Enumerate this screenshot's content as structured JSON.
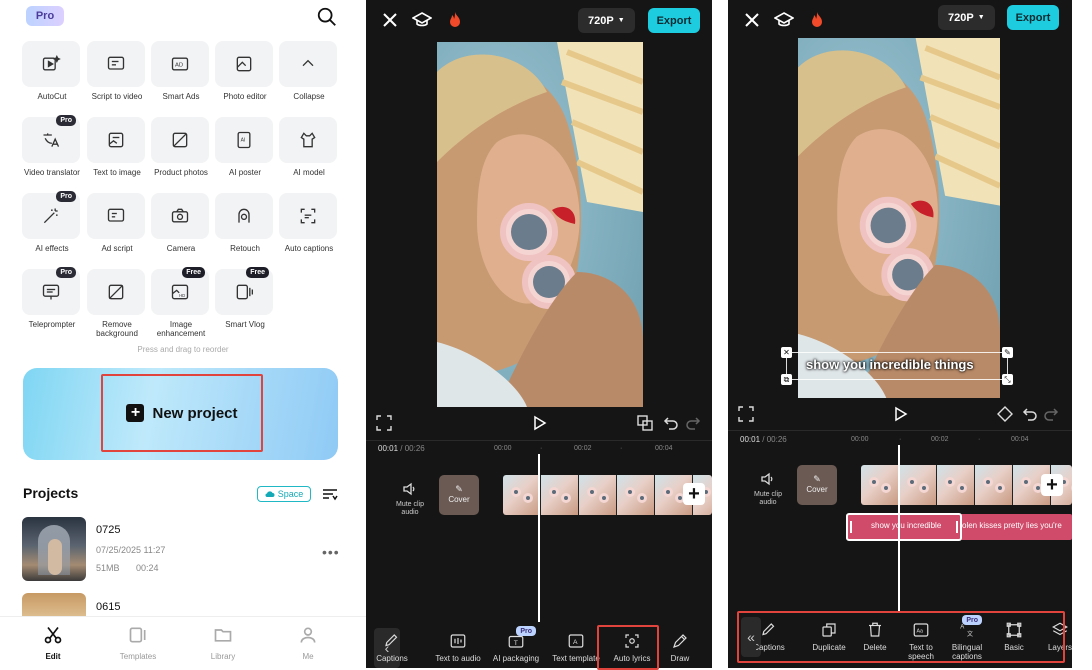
{
  "left_panel": {
    "pro_badge": "Pro",
    "tools": [
      {
        "label": "AutoCut",
        "icon": "autocut-icon",
        "badge": ""
      },
      {
        "label": "Script to video",
        "icon": "script-to-video-icon",
        "badge": ""
      },
      {
        "label": "Smart Ads",
        "icon": "smart-ads-icon",
        "badge": ""
      },
      {
        "label": "Photo editor",
        "icon": "photo-editor-icon",
        "badge": ""
      },
      {
        "label": "Collapse",
        "icon": "chevron-up-icon",
        "badge": ""
      },
      {
        "label": "Video translator",
        "icon": "translate-icon",
        "badge": "Pro"
      },
      {
        "label": "Text to image",
        "icon": "text-to-image-icon",
        "badge": ""
      },
      {
        "label": "Product photos",
        "icon": "product-photos-icon",
        "badge": ""
      },
      {
        "label": "AI poster",
        "icon": "ai-poster-icon",
        "badge": ""
      },
      {
        "label": "AI model",
        "icon": "ai-model-icon",
        "badge": ""
      },
      {
        "label": "AI effects",
        "icon": "magic-wand-icon",
        "badge": "Pro"
      },
      {
        "label": "Ad script",
        "icon": "ad-script-icon",
        "badge": ""
      },
      {
        "label": "Camera",
        "icon": "camera-icon",
        "badge": ""
      },
      {
        "label": "Retouch",
        "icon": "retouch-icon",
        "badge": ""
      },
      {
        "label": "Auto captions",
        "icon": "auto-captions-icon",
        "badge": ""
      },
      {
        "label": "Teleprompter",
        "icon": "teleprompter-icon",
        "badge": "Pro"
      },
      {
        "label": "Remove background",
        "icon": "remove-background-icon",
        "badge": ""
      },
      {
        "label": "Image enhancement",
        "icon": "image-hd-icon",
        "badge": "Free"
      },
      {
        "label": "Smart Vlog",
        "icon": "smart-vlog-icon",
        "badge": "Free"
      }
    ],
    "drag_hint": "Press and drag to reorder",
    "new_project_label": "New project",
    "projects_title": "Projects",
    "space_label": "Space",
    "projects": [
      {
        "name": "0725",
        "date": "07/25/2025 11:27",
        "size": "51MB",
        "duration": "00:24"
      },
      {
        "name": "0615",
        "date": "",
        "size": "",
        "duration": ""
      }
    ],
    "nav": [
      {
        "label": "Edit",
        "icon": "scissors-icon",
        "active": true
      },
      {
        "label": "Templates",
        "icon": "templates-icon",
        "active": false
      },
      {
        "label": "Library",
        "icon": "folder-icon",
        "active": false
      },
      {
        "label": "Me",
        "icon": "user-icon",
        "active": false
      }
    ]
  },
  "editor1": {
    "resolution": "720P",
    "export_label": "Export",
    "current_time": "00:01",
    "total_time": "00:26",
    "ticks": [
      "00:00",
      "00:02",
      "00:04"
    ],
    "mute_label": "Mute clip audio",
    "cover_label": "Cover",
    "tools": [
      {
        "label": "Captions",
        "icon": "captions-icon",
        "badge": ""
      },
      {
        "label": "Text to audio",
        "icon": "text-to-audio-icon",
        "badge": ""
      },
      {
        "label": "AI packaging",
        "icon": "ai-packaging-icon",
        "badge": "Pro"
      },
      {
        "label": "Text template",
        "icon": "text-template-icon",
        "badge": ""
      },
      {
        "label": "Auto lyrics",
        "icon": "auto-lyrics-icon",
        "badge": ""
      },
      {
        "label": "Draw",
        "icon": "pen-icon",
        "badge": ""
      }
    ]
  },
  "editor2": {
    "resolution": "720P",
    "export_label": "Export",
    "caption_text": "show you incredible things",
    "current_time": "00:01",
    "total_time": "00:26",
    "ticks": [
      "00:00",
      "00:02",
      "00:04"
    ],
    "mute_label": "Mute clip audio",
    "cover_label": "Cover",
    "subtitle_clip_1": "show you incredible",
    "subtitle_clip_2": "olen kisses pretty lies you're",
    "tools": [
      {
        "label": "Captions",
        "icon": "captions-icon",
        "badge": ""
      },
      {
        "label": "Duplicate",
        "icon": "duplicate-icon",
        "badge": ""
      },
      {
        "label": "Delete",
        "icon": "trash-icon",
        "badge": ""
      },
      {
        "label": "Text to speech",
        "icon": "text-to-speech-icon",
        "badge": ""
      },
      {
        "label": "Bilingual captions",
        "icon": "bilingual-icon",
        "badge": "Pro"
      },
      {
        "label": "Basic",
        "icon": "basic-icon",
        "badge": ""
      },
      {
        "label": "Layers",
        "icon": "layers-icon",
        "badge": ""
      }
    ]
  },
  "colors": {
    "accent": "#1ecce0",
    "highlight": "#e0443c",
    "editor_bg": "#151515",
    "subtitle_track": "#d04a6a"
  }
}
